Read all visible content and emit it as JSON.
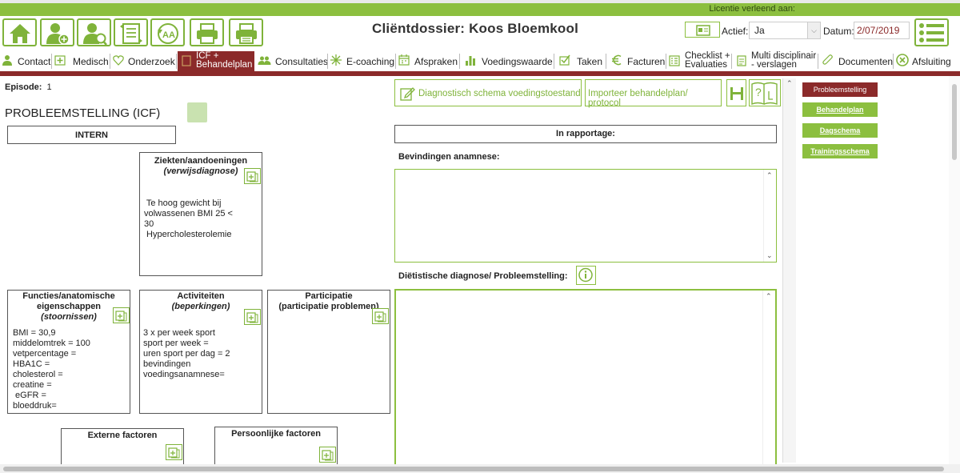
{
  "license": {
    "text": "Licentie verleend aan:"
  },
  "toolbar": {
    "buttons": [
      {
        "icon": "home-icon"
      },
      {
        "icon": "add-client-icon"
      },
      {
        "icon": "search-client-icon"
      },
      {
        "icon": "transfer-list-icon"
      },
      {
        "icon": "refresh-language-icon"
      },
      {
        "icon": "print-icon"
      },
      {
        "icon": "print-list-icon"
      }
    ]
  },
  "header": {
    "title": "Cliëntdossier:  Koos  Bloemkool",
    "actief_label": "Actief:",
    "actief_value": "Ja",
    "datum_label": "Datum:",
    "datum_value": "2/07/2019"
  },
  "nav": {
    "tabs": [
      {
        "label": "Contact",
        "icon": "person-icon"
      },
      {
        "label": "Medisch",
        "icon": "medical-icon"
      },
      {
        "label": "Onderzoek",
        "icon": "heart-icon"
      },
      {
        "label_1": "ICF +",
        "label_2": "Behandelplan",
        "icon": "document-icon",
        "active": true
      },
      {
        "label": "Consultaties",
        "icon": "people-icon"
      },
      {
        "label": "E-coaching",
        "icon": "sparkle-icon"
      },
      {
        "label": "Afspraken",
        "icon": "calendar-icon"
      },
      {
        "label": "Voedingswaarde",
        "icon": "bar-chart-icon"
      },
      {
        "label": "Taken",
        "icon": "checkmark-icon"
      },
      {
        "label": "Facturen",
        "icon": "euro-icon"
      },
      {
        "label_1": "Checklist +",
        "label_2": "Evaluaties",
        "icon": "checklist-icon"
      },
      {
        "label_1": "Multi disciplinair",
        "label_2": "- verslagen",
        "icon": "report-icon"
      },
      {
        "label": "Documenten",
        "icon": "paperclip-icon"
      },
      {
        "label": "Afsluiting",
        "icon": "close-circle-icon"
      }
    ]
  },
  "episode": {
    "label": "Episode:",
    "value": "1"
  },
  "icf": {
    "title": "PROBLEEMSTELLING (ICF)",
    "intern": "INTERN",
    "ziekten": {
      "title": "Ziekten/aandoeningen",
      "subtitle": "(verwijsdiagnose)",
      "content": " Te hoog gewicht bij\nvolwassenen BMI 25 <\n30\n Hypercholesterolemie"
    },
    "functies": {
      "title_1": "Functies/anatomische",
      "title_2": "eigenschappen",
      "subtitle": "(stoornissen)",
      "content": "BMI = 30,9\nmiddelomtrek = 100\nvetpercentage =\nHBA1C =\ncholesterol =\ncreatine =\n eGFR =\nbloeddruk="
    },
    "activiteiten": {
      "title": "Activiteiten",
      "subtitle": "(beperkingen)",
      "content": "3 x per week sport\nsport per week =\nuren sport per dag = 2\nbevindingen\nvoedingsanamnese="
    },
    "participatie": {
      "title": "Participatie",
      "subtitle": "(participatie problemen)"
    },
    "externe": {
      "title": "Externe factoren"
    },
    "persoonlijke": {
      "title": "Persoonlijke factoren"
    }
  },
  "actions": {
    "diagnostisch": "Diagnostisch schema voedingstoestand",
    "importeer": "Importeer behandelplan/ protocol"
  },
  "rapportage": {
    "header": "In rapportage:",
    "bevindingen_label": "Bevindingen anamnese:",
    "bevindingen_value": "",
    "diagnose_label": "Diëtistische diagnose/ Probleemstelling:",
    "diagnose_value": ""
  },
  "right_menu": {
    "items": [
      {
        "label": "Probleemstelling",
        "active": true
      },
      {
        "label": "Behandelplan"
      },
      {
        "label": "Dagschema"
      },
      {
        "label": "Trainingsschema"
      }
    ]
  },
  "colors": {
    "brand_green": "#8cbf3f",
    "brand_red": "#8b2a2a"
  }
}
